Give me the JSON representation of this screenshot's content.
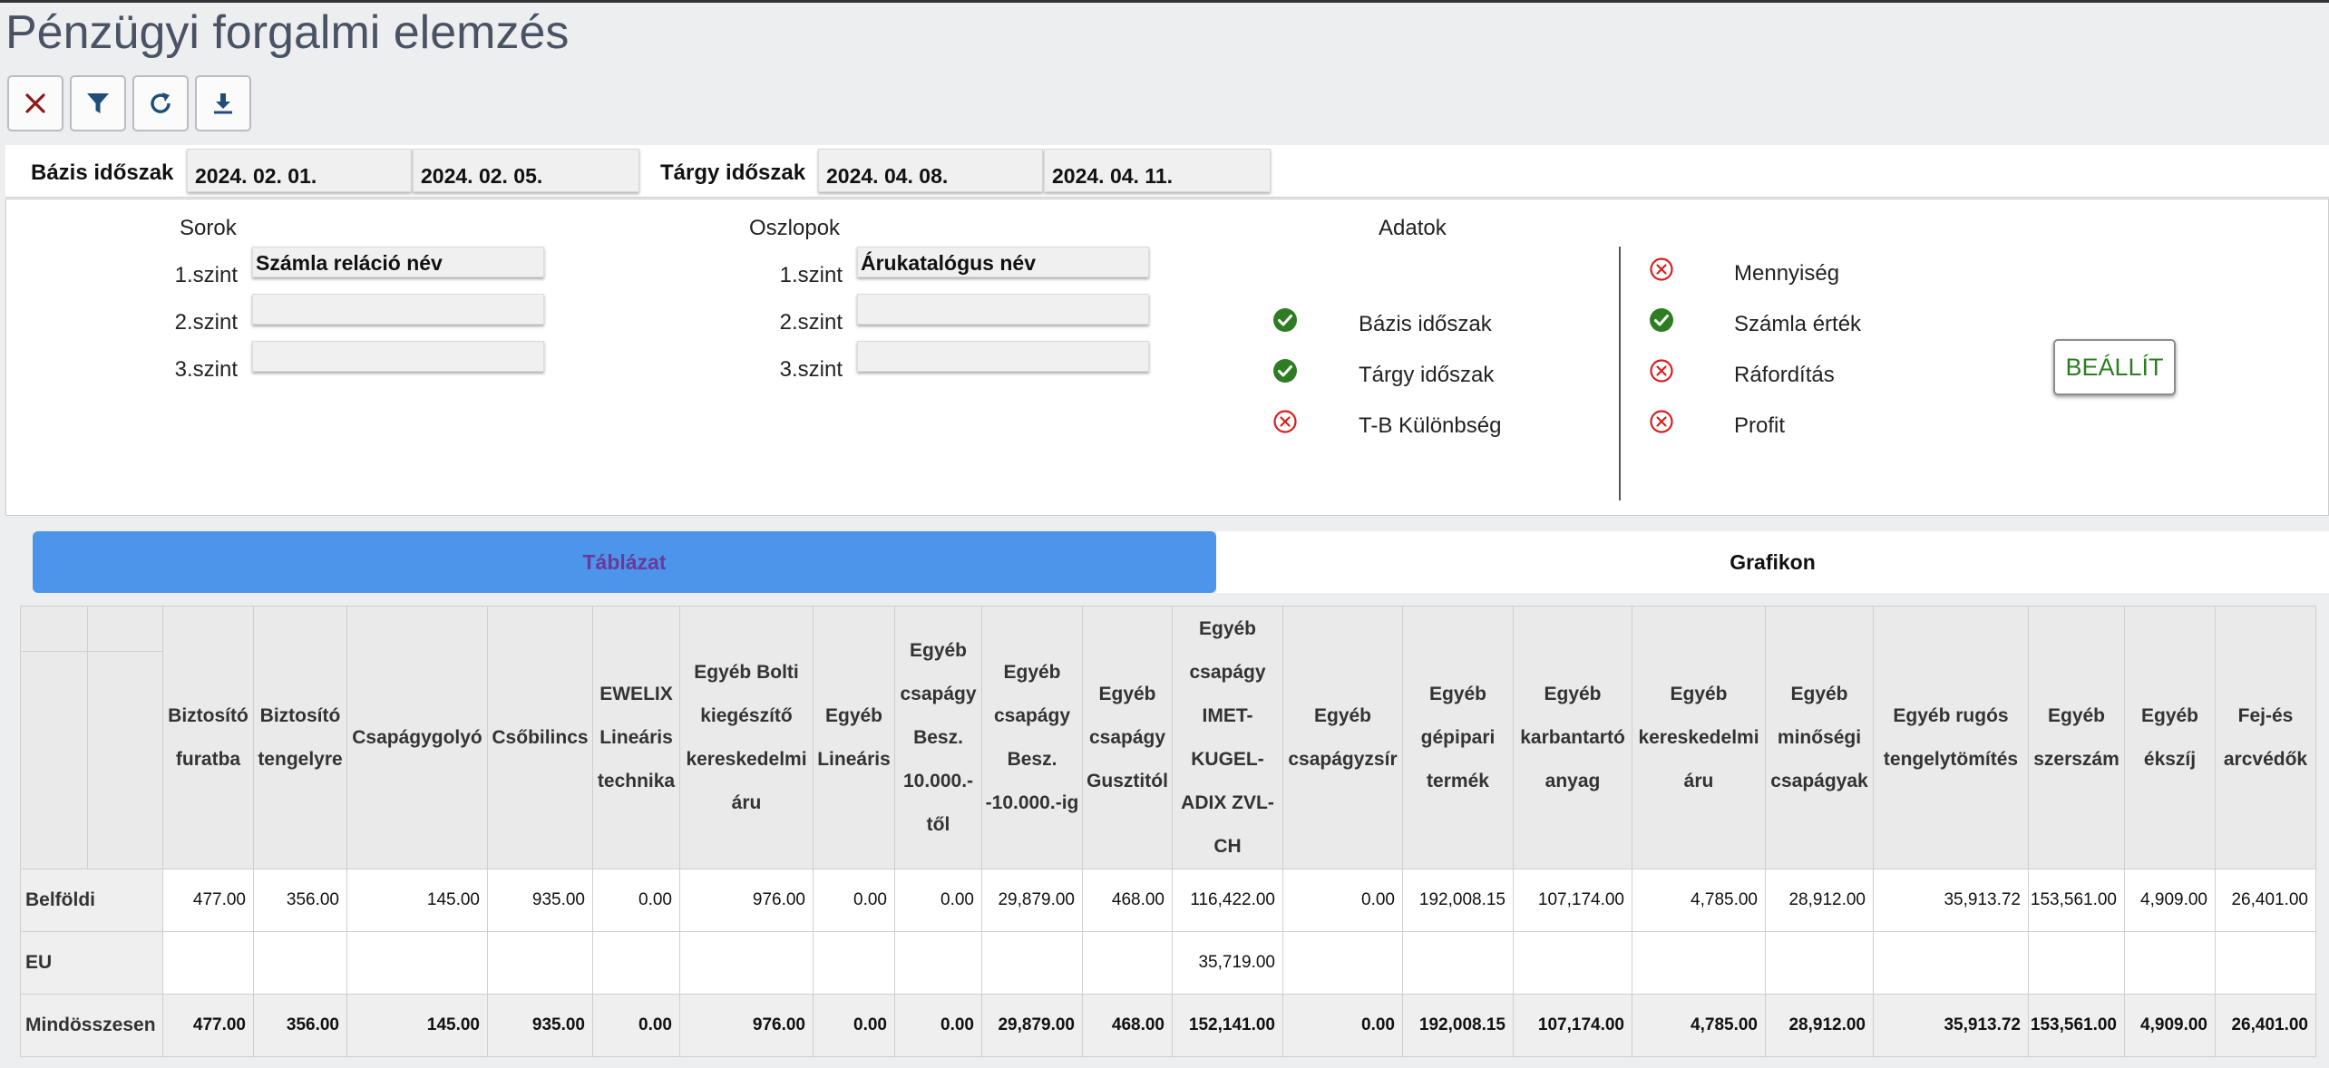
{
  "page": {
    "title": "Pénzügyi forgalmi elemzés"
  },
  "toolbar": {
    "buttons": [
      {
        "icon": "close-icon",
        "color": "#8b1a1a"
      },
      {
        "icon": "filter-icon",
        "color": "#1f4e79"
      },
      {
        "icon": "refresh-icon",
        "color": "#1f4e79"
      },
      {
        "icon": "download-icon",
        "color": "#1f4e79"
      }
    ]
  },
  "period": {
    "base_label": "Bázis időszak",
    "base_from": "2024. 02. 01.",
    "base_to": "2024. 02. 05.",
    "target_label": "Tárgy időszak",
    "target_from": "2024. 04. 08.",
    "target_to": "2024. 04. 11."
  },
  "rows": {
    "header": "Sorok",
    "levels": [
      {
        "label": "1.szint",
        "value": "Számla reláció név"
      },
      {
        "label": "2.szint",
        "value": ""
      },
      {
        "label": "3.szint",
        "value": ""
      }
    ]
  },
  "columns": {
    "header": "Oszlopok",
    "levels": [
      {
        "label": "1.szint",
        "value": "Árukatalógus név"
      },
      {
        "label": "2.szint",
        "value": ""
      },
      {
        "label": "3.szint",
        "value": ""
      }
    ]
  },
  "data": {
    "header": "Adatok",
    "left": [
      {
        "label": "Bázis időszak",
        "checked": true
      },
      {
        "label": "Tárgy időszak",
        "checked": true
      },
      {
        "label": "T-B Különbség",
        "checked": false
      }
    ],
    "right": [
      {
        "label": "Mennyiség",
        "checked": false
      },
      {
        "label": "Számla érték",
        "checked": true
      },
      {
        "label": "Ráfordítás",
        "checked": false
      },
      {
        "label": "Profit",
        "checked": false
      }
    ]
  },
  "apply_button": "BEÁLLÍT",
  "colors": {
    "accent_tab": "#4d95eb",
    "ok": "#2e7d22",
    "error": "#d62020"
  },
  "tabs": [
    {
      "label": "Táblázat",
      "active": true
    },
    {
      "label": "Grafikon",
      "active": false
    }
  ],
  "table": {
    "columns": [
      "Biztosító furatba",
      "Biztosító tengelyre",
      "Csapágygolyó",
      "Csőbilincs",
      "EWELIX Lineáris technika",
      "Egyéb Bolti kiegészítő kereskedelmi áru",
      "Egyéb Lineáris",
      "Egyéb csapágy Besz. 10.000.-től",
      "Egyéb csapágy Besz. -10.000.-ig",
      "Egyéb csapágy Gusztitól",
      "Egyéb csapágy IMET-KUGEL-ADIX ZVL-CH",
      "Egyéb csapágyzsír",
      "Egyéb gépipari termék",
      "Egyéb karbantartó anyag",
      "Egyéb kereskedelmi áru",
      "Egyéb minőségi csapágyak",
      "Egyéb rugós tengelytömítés",
      "Egyéb szerszám",
      "Egyéb ékszíj",
      "Fej-és arcvédők"
    ],
    "rows": [
      {
        "label": "Belföldi",
        "values": [
          "477.00",
          "356.00",
          "145.00",
          "935.00",
          "0.00",
          "976.00",
          "0.00",
          "0.00",
          "29,879.00",
          "468.00",
          "116,422.00",
          "0.00",
          "192,008.15",
          "107,174.00",
          "4,785.00",
          "28,912.00",
          "35,913.72",
          "153,561.00",
          "4,909.00",
          "26,401.00"
        ]
      },
      {
        "label": "EU",
        "values": [
          "",
          "",
          "",
          "",
          "",
          "",
          "",
          "",
          "",
          "",
          "35,719.00",
          "",
          "",
          "",
          "",
          "",
          "",
          "",
          "",
          ""
        ]
      },
      {
        "label": "Mindösszesen",
        "values": [
          "477.00",
          "356.00",
          "145.00",
          "935.00",
          "0.00",
          "976.00",
          "0.00",
          "0.00",
          "29,879.00",
          "468.00",
          "152,141.00",
          "0.00",
          "192,008.15",
          "107,174.00",
          "4,785.00",
          "28,912.00",
          "35,913.72",
          "153,561.00",
          "4,909.00",
          "26,401.00"
        ],
        "total": true
      }
    ]
  }
}
